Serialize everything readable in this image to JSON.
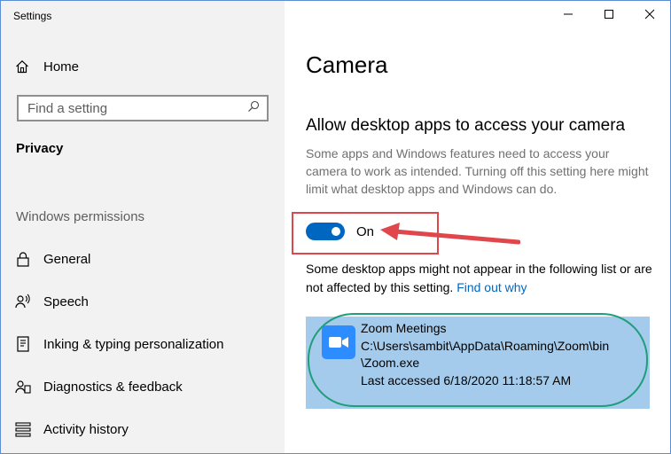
{
  "window": {
    "title": "Settings",
    "controls": [
      "minimize-icon",
      "maximize-icon",
      "close-icon"
    ]
  },
  "sidebar": {
    "home_label": "Home",
    "search_placeholder": "Find a setting",
    "section_title": "Privacy",
    "group_label": "Windows permissions",
    "items": [
      {
        "label": "General",
        "icon": "lock-icon"
      },
      {
        "label": "Speech",
        "icon": "speech-icon"
      },
      {
        "label": "Inking & typing personalization",
        "icon": "inking-icon"
      },
      {
        "label": "Diagnostics & feedback",
        "icon": "diagnostics-icon"
      },
      {
        "label": "Activity history",
        "icon": "activity-history-icon"
      }
    ]
  },
  "main": {
    "title": "Camera",
    "subtitle": "Allow desktop apps to access your camera",
    "description": "Some apps and Windows features need to access your camera to work as intended. Turning off this setting here might limit what desktop apps and Windows can do.",
    "toggle": {
      "state": "On",
      "on": true
    },
    "note": "Some desktop apps might not appear in the following list or are not affected by this setting.",
    "note_link": "Find out why",
    "apps": [
      {
        "name": "Zoom Meetings",
        "path_line1": "C:\\Users\\sambit\\AppData\\Roaming\\Zoom\\bin",
        "path_line2": "\\Zoom.exe",
        "last_accessed": "Last accessed 6/18/2020 11:18:57 AM",
        "icon": "zoom-camera-icon"
      }
    ]
  },
  "colors": {
    "accent": "#0067c0",
    "sidebar_bg": "#f2f2f2",
    "selected_row": "#a4cbec",
    "annotation_red": "#e0474c",
    "annotation_green": "#1e9e7a",
    "zoom_blue": "#2d8cff"
  }
}
